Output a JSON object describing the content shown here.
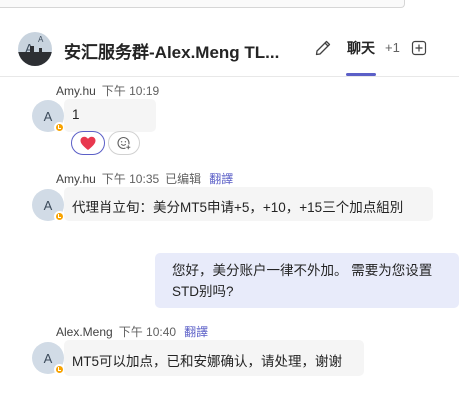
{
  "header": {
    "title": "安汇服务群-Alex.Meng TL...",
    "active_tab": "聊天",
    "more_tabs": "+1",
    "avatar_letters": [
      "A",
      "A"
    ]
  },
  "messages": [
    {
      "author": "Amy.hu",
      "time": "下午 10:19",
      "avatar_initial": "A",
      "text": "1",
      "reactions": [
        "heart-reaction",
        "add-reaction"
      ]
    },
    {
      "author": "Amy.hu",
      "time": "下午 10:35",
      "edited": "已编辑",
      "translate": "翻譯",
      "avatar_initial": "A",
      "text": "代理肖立旬：美分MT5申请+5，+10，+15三个加点組別"
    },
    {
      "mine": true,
      "text": "您好，美分账户一律不外加。 需要为您设置STD别吗?"
    },
    {
      "author": "Alex.Meng",
      "time": "下午 10:40",
      "translate": "翻譯",
      "avatar_initial": "A",
      "text": "MT5可以加点，已和安娜确认，请处理，谢谢"
    }
  ],
  "colors": {
    "accent": "#5b5fc7",
    "presence_away": "#f8a300",
    "bubble_other": "#f5f5f5",
    "bubble_mine": "#e8ebfa",
    "heart": "#e8384f"
  }
}
